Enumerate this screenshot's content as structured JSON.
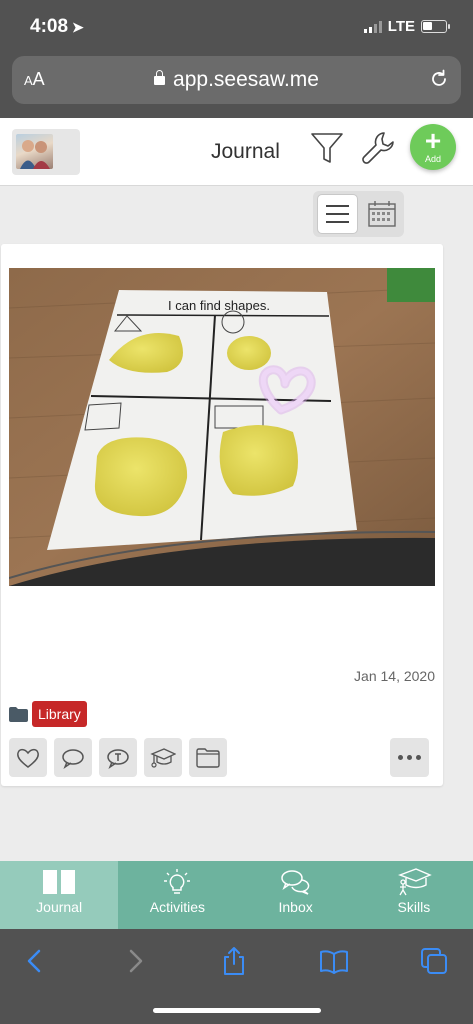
{
  "status": {
    "time": "4:08",
    "carrier": "LTE"
  },
  "browser": {
    "text_size_label_small": "A",
    "text_size_label_large": "A",
    "url": "app.seesaw.me"
  },
  "header": {
    "title": "Journal",
    "add_label": "Add"
  },
  "post": {
    "worksheet_title": "I can find shapes.",
    "date": "Jan 14, 2020",
    "folder_tag": "Library"
  },
  "nav": {
    "items": [
      {
        "label": "Journal"
      },
      {
        "label": "Activities"
      },
      {
        "label": "Inbox"
      },
      {
        "label": "Skills"
      }
    ]
  },
  "colors": {
    "brand_green": "#6ecb5a",
    "nav_bg": "#6db39e",
    "nav_active": "#95cbbb",
    "tag_red": "#c62828",
    "safari_blue": "#3b8cf5"
  },
  "icons": [
    "filter-icon",
    "wrench-icon",
    "list-view-icon",
    "calendar-view-icon",
    "heart-icon",
    "comment-icon",
    "text-comment-icon",
    "graduation-cap-icon",
    "folder-icon",
    "more-icon",
    "book-icon",
    "lightbulb-icon",
    "chat-bubbles-icon",
    "skills-icon",
    "back-icon",
    "forward-icon",
    "share-icon",
    "bookmarks-icon",
    "tabs-icon"
  ]
}
